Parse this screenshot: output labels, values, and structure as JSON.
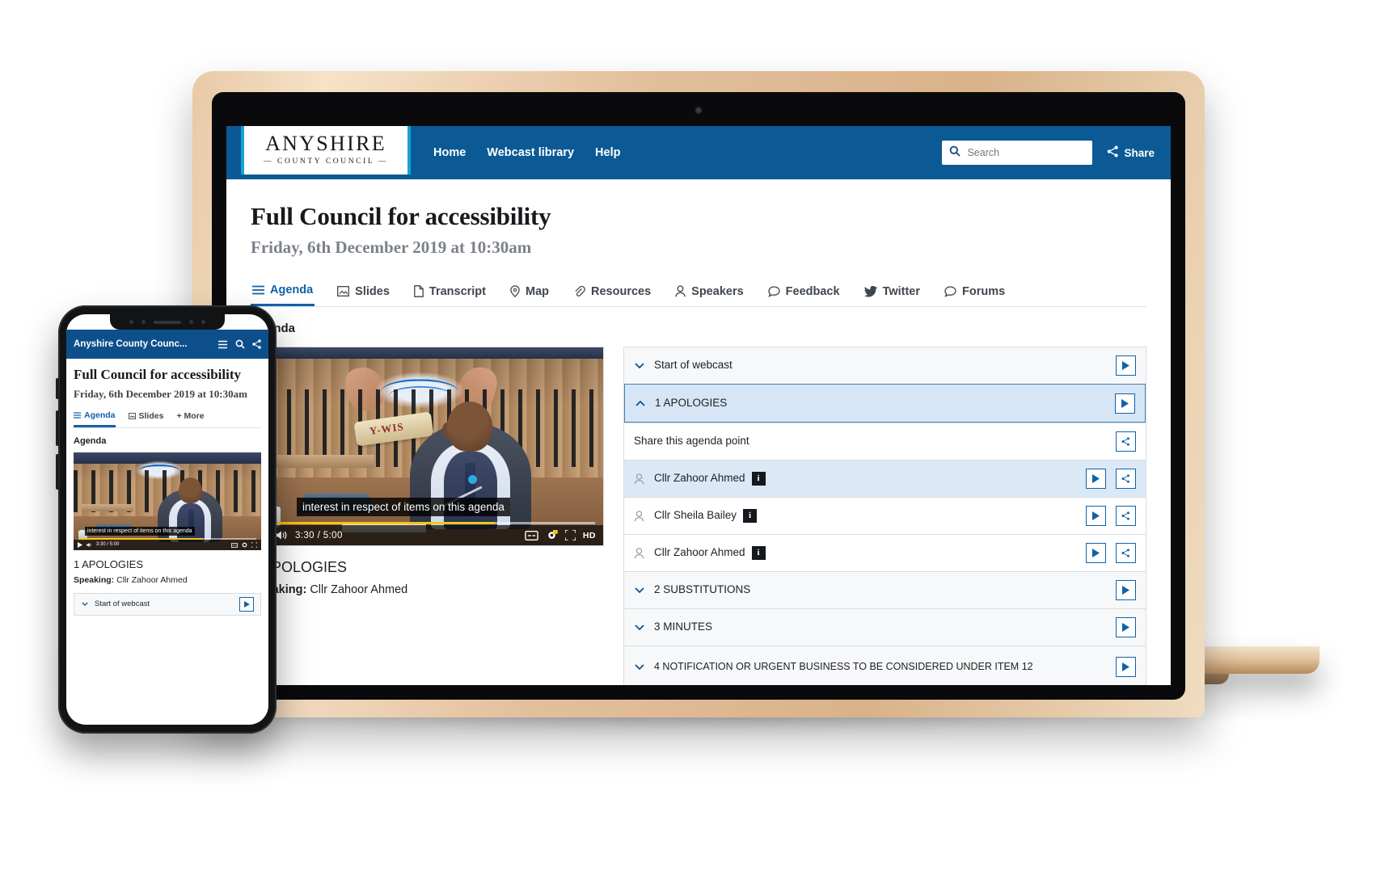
{
  "header": {
    "logo_main": "ANYSHIRE",
    "logo_sub": "— COUNTY COUNCIL —",
    "nav": [
      {
        "label": "Home"
      },
      {
        "label": "Webcast library"
      },
      {
        "label": "Help"
      }
    ],
    "search_placeholder": "Search",
    "search_value": "",
    "share_label": "Share",
    "brand_color": "#0b5a95",
    "accent_color": "#17a2d6"
  },
  "page": {
    "title": "Full Council for accessibility",
    "date": "Friday, 6th December 2019 at 10:30am",
    "section_heading": "Agenda"
  },
  "tabs": [
    {
      "label": "Agenda",
      "icon": "list-icon",
      "active": true
    },
    {
      "label": "Slides",
      "icon": "image-icon",
      "active": false
    },
    {
      "label": "Transcript",
      "icon": "document-icon",
      "active": false
    },
    {
      "label": "Map",
      "icon": "pin-icon",
      "active": false
    },
    {
      "label": "Resources",
      "icon": "paperclip-icon",
      "active": false
    },
    {
      "label": "Speakers",
      "icon": "person-icon",
      "active": false
    },
    {
      "label": "Feedback",
      "icon": "comment-icon",
      "active": false
    },
    {
      "label": "Twitter",
      "icon": "twitter-icon",
      "active": false
    },
    {
      "label": "Forums",
      "icon": "chat-icon",
      "active": false
    }
  ],
  "player": {
    "caption": "interest in respect of items on this agenda",
    "current_time": "3:30",
    "duration": "5:00",
    "time_display": "3:30 / 5:00",
    "progress_percent": 70,
    "quality_badge": "HD",
    "scroll_text": "Y-WIS"
  },
  "now_playing": {
    "title": "1 APOLOGIES",
    "speaking_label": "Speaking:",
    "speaking_name": "Cllr Zahoor Ahmed"
  },
  "agenda": {
    "share_row_label": "Share this agenda point",
    "items": [
      {
        "label": "Start of webcast",
        "state": "collapsed",
        "active": false,
        "type": "agenda"
      },
      {
        "label": "1 APOLOGIES",
        "state": "expanded",
        "active": true,
        "type": "agenda"
      },
      {
        "label": "Share this agenda point",
        "type": "share"
      },
      {
        "label": "Cllr Zahoor Ahmed",
        "type": "speaker",
        "info": "i",
        "highlighted": true
      },
      {
        "label": "Cllr Sheila Bailey",
        "type": "speaker",
        "info": "i",
        "highlighted": false
      },
      {
        "label": "Cllr Zahoor Ahmed",
        "type": "speaker",
        "info": "i",
        "highlighted": false
      },
      {
        "label": "2 SUBSTITUTIONS",
        "state": "collapsed",
        "active": false,
        "type": "agenda"
      },
      {
        "label": "3 MINUTES",
        "state": "collapsed",
        "active": false,
        "type": "agenda"
      },
      {
        "label": "4 NOTIFICATION OR URGENT BUSINESS TO BE CONSIDERED UNDER ITEM 12",
        "state": "collapsed",
        "active": false,
        "type": "agenda"
      }
    ]
  },
  "phone": {
    "brand": "Anyshire County Counc...",
    "title": "Full Council for accessibility",
    "date": "Friday, 6th December 2019 at 10:30am",
    "section_heading": "Agenda",
    "tabs": [
      {
        "label": "Agenda",
        "active": true
      },
      {
        "label": "Slides",
        "active": false
      },
      {
        "label": "+ More",
        "active": false
      }
    ],
    "caption": "interest in respect of items on this agenda",
    "time_display": "3:30 / 5:00",
    "vid_title": "1 APOLOGIES",
    "speaking_label": "Speaking:",
    "speaking_name": "Cllr Zahoor Ahmed",
    "agenda_first": "Start of webcast"
  }
}
